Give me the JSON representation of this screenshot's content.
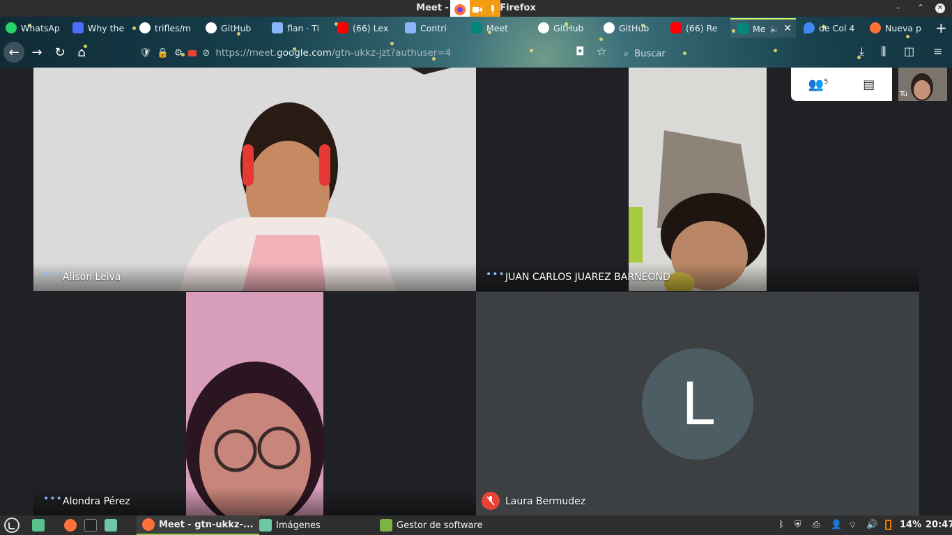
{
  "window": {
    "title": "Meet - gtn-ukkz-jzt - Mozilla Firefox",
    "title_visible": "Meet - gtn-         zilla Firefox"
  },
  "tabs": [
    {
      "label": "WhatsAp",
      "icon": "whatsapp-icon",
      "color": "#25d366"
    },
    {
      "label": "Why the",
      "icon": "doc-icon",
      "color": "#4a6cf7"
    },
    {
      "label": "trifles/m",
      "icon": "github-icon",
      "color": "#ffffff"
    },
    {
      "label": "GitHub",
      "icon": "github-icon",
      "color": "#ffffff"
    },
    {
      "label": "flan · Ti",
      "icon": "doc-icon",
      "color": "#8ab4f8"
    },
    {
      "label": "(66) Lex",
      "icon": "youtube-icon",
      "color": "#ff0000"
    },
    {
      "label": "Contri",
      "icon": "doc-icon",
      "color": "#8ab4f8"
    },
    {
      "label": "Meet",
      "icon": "meet-icon",
      "color": "#00897b"
    },
    {
      "label": "GitHub",
      "icon": "github-icon",
      "color": "#ffffff"
    },
    {
      "label": "GitHub",
      "icon": "github-icon",
      "color": "#ffffff"
    },
    {
      "label": "(66) Re",
      "icon": "youtube-icon",
      "color": "#ff0000"
    },
    {
      "label": "Me",
      "icon": "meet-icon",
      "color": "#00897b",
      "active": true
    },
    {
      "label": "de Col 4",
      "icon": "maps-icon",
      "color": "#4285f4"
    },
    {
      "label": "Nueva p",
      "icon": "firefox-icon",
      "color": "#ff7139"
    }
  ],
  "navbar": {
    "url_prefix": "https://meet.",
    "url_domain": "google.com",
    "url_rest": "/gtn-ukkz-jzt?authuser=4",
    "search_placeholder": "Buscar"
  },
  "participants": [
    {
      "name": "Alison Leiva"
    },
    {
      "name": "JUAN CARLOS JUAREZ BARNEOND"
    },
    {
      "name": "Alondra Pérez"
    },
    {
      "name": "Laura Bermudez",
      "initial": "L",
      "muted": true
    }
  ],
  "panel": {
    "participant_count": "5",
    "self_label": "Tú"
  },
  "taskbar": {
    "items": [
      {
        "label": "Meet - gtn-ukkz-...",
        "active": true
      },
      {
        "label": "Imágenes"
      },
      {
        "label": "Gestor de software"
      }
    ],
    "battery": "14%",
    "clock": "20:47"
  },
  "colors": {
    "accent": "#8ab4f8",
    "muted_red": "#ea4335",
    "avatar_bg": "#4e5d64"
  }
}
